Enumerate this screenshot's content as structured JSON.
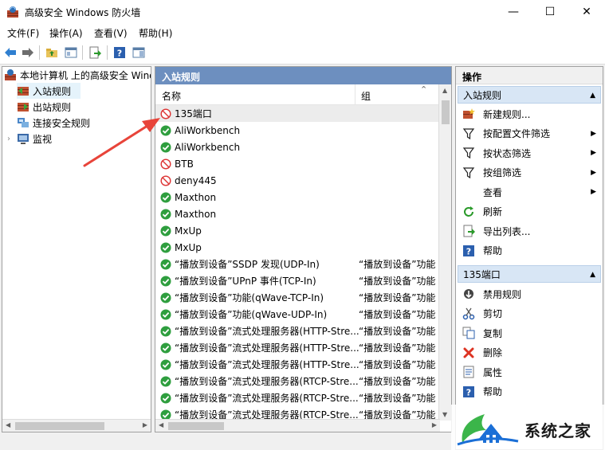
{
  "window": {
    "title": "高级安全 Windows 防火墙",
    "controls": {
      "minimize": "—",
      "maximize": "☐",
      "close": "✕"
    }
  },
  "menu": [
    "文件(F)",
    "操作(A)",
    "查看(V)",
    "帮助(H)"
  ],
  "tree": {
    "root": "本地计算机 上的高级安全 Windows",
    "items": [
      {
        "label": "入站规则",
        "selected": true
      },
      {
        "label": "出站规则"
      },
      {
        "label": "连接安全规则"
      },
      {
        "label": "监视",
        "expander": "›"
      }
    ]
  },
  "list": {
    "header": "入站规则",
    "columns": {
      "name": "名称",
      "group": "组"
    },
    "rows": [
      {
        "name": "135端口",
        "group": "",
        "state": "blocked",
        "selected": true
      },
      {
        "name": "AliWorkbench",
        "group": "",
        "state": "allowed"
      },
      {
        "name": "AliWorkbench",
        "group": "",
        "state": "allowed"
      },
      {
        "name": "BTB",
        "group": "",
        "state": "blocked"
      },
      {
        "name": "deny445",
        "group": "",
        "state": "blocked"
      },
      {
        "name": "Maxthon",
        "group": "",
        "state": "allowed"
      },
      {
        "name": "Maxthon",
        "group": "",
        "state": "allowed"
      },
      {
        "name": "MxUp",
        "group": "",
        "state": "allowed"
      },
      {
        "name": "MxUp",
        "group": "",
        "state": "allowed"
      },
      {
        "name": "“播放到设备”SSDP 发现(UDP-In)",
        "group": "“播放到设备”功能",
        "state": "allowed"
      },
      {
        "name": "“播放到设备”UPnP 事件(TCP-In)",
        "group": "“播放到设备”功能",
        "state": "allowed"
      },
      {
        "name": "“播放到设备”功能(qWave-TCP-In)",
        "group": "“播放到设备”功能",
        "state": "allowed"
      },
      {
        "name": "“播放到设备”功能(qWave-UDP-In)",
        "group": "“播放到设备”功能",
        "state": "allowed"
      },
      {
        "name": "“播放到设备”流式处理服务器(HTTP-Stre...",
        "group": "“播放到设备”功能",
        "state": "allowed"
      },
      {
        "name": "“播放到设备”流式处理服务器(HTTP-Stre...",
        "group": "“播放到设备”功能",
        "state": "allowed"
      },
      {
        "name": "“播放到设备”流式处理服务器(HTTP-Stre...",
        "group": "“播放到设备”功能",
        "state": "allowed"
      },
      {
        "name": "“播放到设备”流式处理服务器(RTCP-Stre...",
        "group": "“播放到设备”功能",
        "state": "allowed"
      },
      {
        "name": "“播放到设备”流式处理服务器(RTCP-Stre...",
        "group": "“播放到设备”功能",
        "state": "allowed"
      },
      {
        "name": "“播放到设备”流式处理服务器(RTCP-Stre...",
        "group": "“播放到设备”功能",
        "state": "allowed"
      }
    ]
  },
  "actions": {
    "header": "操作",
    "section1": {
      "title": "入站规则",
      "items": [
        {
          "label": "新建规则...",
          "icon": "new-rule-icon"
        },
        {
          "label": "按配置文件筛选",
          "icon": "filter-icon",
          "submenu": true
        },
        {
          "label": "按状态筛选",
          "icon": "filter-icon",
          "submenu": true
        },
        {
          "label": "按组筛选",
          "icon": "filter-icon",
          "submenu": true
        },
        {
          "label": "查看",
          "icon": "",
          "submenu": true
        },
        {
          "label": "刷新",
          "icon": "refresh-icon"
        },
        {
          "label": "导出列表...",
          "icon": "export-icon"
        },
        {
          "label": "帮助",
          "icon": "help-icon"
        }
      ]
    },
    "section2": {
      "title": "135端口",
      "items": [
        {
          "label": "禁用规则",
          "icon": "disable-icon"
        },
        {
          "label": "剪切",
          "icon": "cut-icon"
        },
        {
          "label": "复制",
          "icon": "copy-icon"
        },
        {
          "label": "删除",
          "icon": "delete-icon"
        },
        {
          "label": "属性",
          "icon": "properties-icon"
        },
        {
          "label": "帮助",
          "icon": "help-icon"
        }
      ]
    }
  },
  "watermark": "系统之家",
  "colors": {
    "header_blue": "#6d8fbf",
    "allowed_green": "#2e9e3e",
    "blocked_red": "#d33",
    "arrow_red": "#e8443a",
    "section_blue": "#d8e6f5"
  }
}
